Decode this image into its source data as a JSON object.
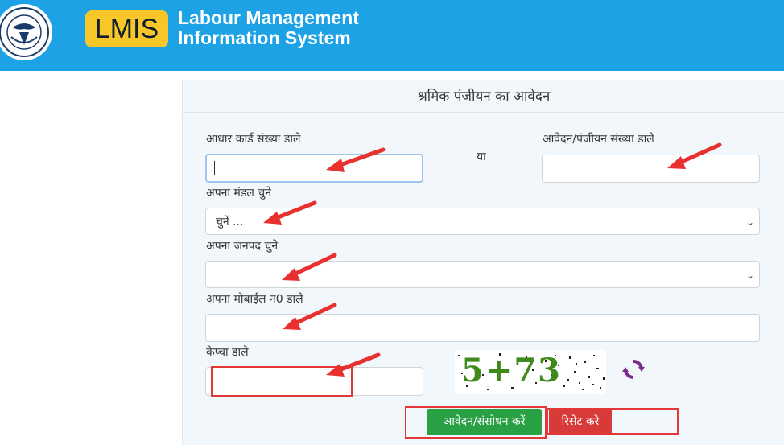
{
  "header": {
    "logo_text": "LMIS",
    "title_line1": "Labour Management",
    "title_line2": "Information System"
  },
  "form": {
    "title": "श्रमिक पंजीयन का आवेदन",
    "aadhaar_label": "आधार कार्ड संख्या डाले",
    "aadhaar_value": "",
    "or_text": "या",
    "application_label": "आवेदन/पंजीयन संख्या डाले",
    "application_value": "",
    "mandal_label": "अपना मंडल चुने",
    "mandal_selected": "चुनें ...",
    "district_label": "अपना जनपद चुने",
    "district_selected": "",
    "mobile_label": "अपना मोबाईल न0 डाले",
    "mobile_value": "",
    "captcha_label": "केप्चा डाले",
    "captcha_value": "",
    "captcha_image_text": "5+73",
    "submit_label": "आवेदन/संसोधन करें",
    "reset_label": "रिसेट करे"
  },
  "colors": {
    "header_bg": "#1ea2e6",
    "logo_bg": "#f7c72a",
    "submit_bg": "#2aa044",
    "reset_bg": "#d83a3a",
    "annotation": "#e23838"
  },
  "icons": {
    "emblem": "up-state-emblem-icon",
    "refresh": "refresh-icon",
    "dropdown": "chevron-down-icon"
  }
}
